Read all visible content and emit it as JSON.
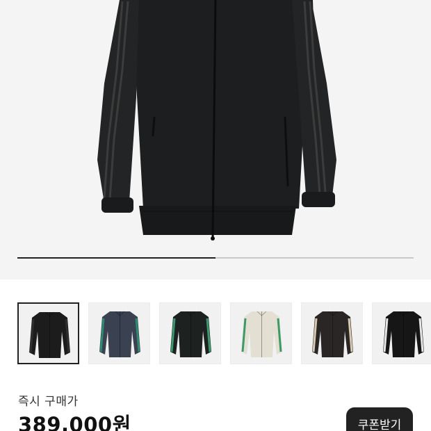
{
  "product": {
    "main_image": "black-track-jacket",
    "gallery_progress": 0.5,
    "selected_thumbnail": 0,
    "thumbnails": [
      {
        "image": "black-track-jacket-black-stripe"
      },
      {
        "image": "navy-track-jacket-teal-stripe"
      },
      {
        "image": "black-track-jacket-green-stripe"
      },
      {
        "image": "ivory-track-jacket-green-stripe"
      },
      {
        "image": "black-track-jacket-beige-stripe"
      },
      {
        "image": "black-track-jacket-white-stripe"
      }
    ]
  },
  "purchase": {
    "label": "즉시 구매가",
    "price": "389,000원",
    "coupon_button": "쿠폰받기"
  },
  "colors": {
    "background": "#ffffff",
    "hero_bg": "#f4f4f4",
    "button_bg": "#222222",
    "progress_active": "#222222",
    "progress_track": "#c9c9c9"
  }
}
